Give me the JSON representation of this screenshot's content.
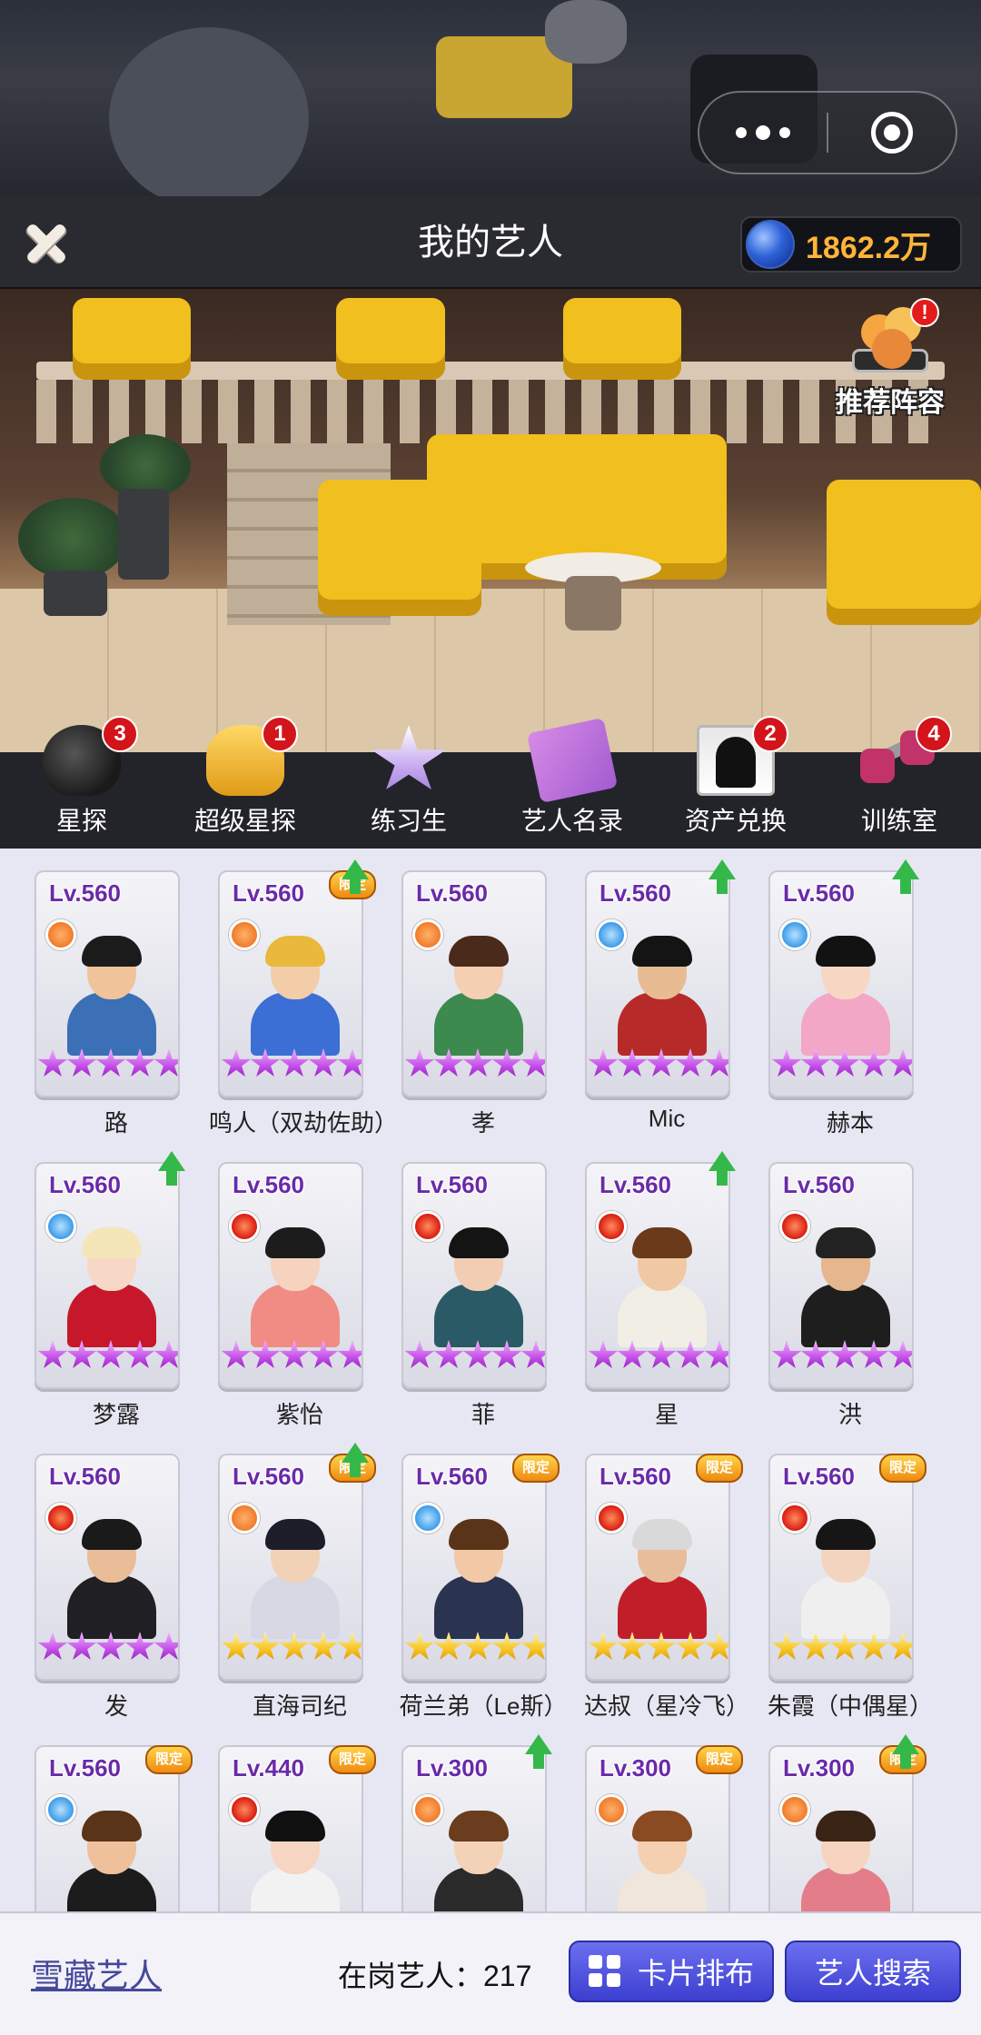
{
  "header": {
    "title": "我的艺人",
    "currency_value": "1862.2万"
  },
  "recommend": {
    "label": "推荐阵容",
    "alert": "!"
  },
  "menu": [
    {
      "label": "星探",
      "icon": "mystery-hat-icon",
      "badge": "3"
    },
    {
      "label": "超级星探",
      "icon": "golden-hat-icon",
      "badge": "1"
    },
    {
      "label": "练习生",
      "icon": "star-icon",
      "badge": ""
    },
    {
      "label": "艺人名录",
      "icon": "roster-book-icon",
      "badge": ""
    },
    {
      "label": "资产兑换",
      "icon": "silhouette-card-icon",
      "badge": "2"
    },
    {
      "label": "训练室",
      "icon": "dumbbell-icon",
      "badge": "4"
    }
  ],
  "artists": [
    {
      "level": "Lv.560",
      "name": "路",
      "element": "orange",
      "stars": "purple",
      "up": false,
      "limited": false,
      "hair": "#1b1b1b",
      "body": "#3b6fb6",
      "skin": "#f0c39a"
    },
    {
      "level": "Lv.560",
      "name": "鸣人（双劫佐助）",
      "element": "orange",
      "stars": "purple",
      "up": true,
      "limited": true,
      "limited_text": "限定",
      "hair": "#e8b93a",
      "body": "#3b6fd6",
      "skin": "#f3cda7"
    },
    {
      "level": "Lv.560",
      "name": "孝",
      "element": "orange",
      "stars": "purple",
      "up": false,
      "limited": false,
      "hair": "#4a2a1a",
      "body": "#3c8a4e",
      "skin": "#f4cfb2"
    },
    {
      "level": "Lv.560",
      "name": "Mic",
      "element": "blue",
      "stars": "purple",
      "up": true,
      "limited": false,
      "hair": "#141414",
      "body": "#b72a2a",
      "skin": "#e9bb93"
    },
    {
      "level": "Lv.560",
      "name": "赫本",
      "element": "blue",
      "stars": "purple",
      "up": true,
      "limited": false,
      "hair": "#121212",
      "body": "#f2a7c6",
      "skin": "#f7d7c4"
    },
    {
      "level": "Lv.560",
      "name": "梦露",
      "element": "blue",
      "stars": "purple",
      "up": true,
      "limited": false,
      "hair": "#f4e6b8",
      "body": "#c6182a",
      "skin": "#f7d8c6"
    },
    {
      "level": "Lv.560",
      "name": "紫怡",
      "element": "red",
      "stars": "purple",
      "up": false,
      "limited": false,
      "hair": "#1c1c1c",
      "body": "#f08c84",
      "skin": "#f6d3be"
    },
    {
      "level": "Lv.560",
      "name": "菲",
      "element": "red",
      "stars": "purple",
      "up": false,
      "limited": false,
      "hair": "#141414",
      "body": "#2a5a66",
      "skin": "#f2cdb3"
    },
    {
      "level": "Lv.560",
      "name": "星",
      "element": "red",
      "stars": "purple",
      "up": true,
      "limited": false,
      "hair": "#6a3a1a",
      "body": "#f1eee6",
      "skin": "#f0c8a4"
    },
    {
      "level": "Lv.560",
      "name": "洪",
      "element": "red",
      "stars": "purple",
      "up": false,
      "limited": false,
      "hair": "#222222",
      "body": "#1e1e1e",
      "skin": "#e6b68e"
    },
    {
      "level": "Lv.560",
      "name": "发",
      "element": "red",
      "stars": "purple",
      "up": false,
      "limited": false,
      "hair": "#1a1a1a",
      "body": "#1f1f24",
      "skin": "#e9bd98"
    },
    {
      "level": "Lv.560",
      "name": "直海司纪",
      "element": "orange",
      "stars": "gold",
      "up": true,
      "limited": true,
      "limited_text": "限定",
      "hair": "#1d1d2a",
      "body": "#d8d8e4",
      "skin": "#f2d2b6"
    },
    {
      "level": "Lv.560",
      "name": "荷兰弟（Le斯）",
      "element": "blue",
      "stars": "gold",
      "up": false,
      "limited": true,
      "limited_text": "限定",
      "hair": "#5a3418",
      "body": "#2a3350",
      "skin": "#f2c8a6"
    },
    {
      "level": "Lv.560",
      "name": "达叔（星冷飞）",
      "element": "red",
      "stars": "gold",
      "up": false,
      "limited": true,
      "limited_text": "限定",
      "hair": "#d9d9d9",
      "body": "#c21e2a",
      "skin": "#e8bd9c"
    },
    {
      "level": "Lv.560",
      "name": "朱霞（中偶星）",
      "element": "red",
      "stars": "gold",
      "up": false,
      "limited": true,
      "limited_text": "限定",
      "hair": "#161616",
      "body": "#efefef",
      "skin": "#f3d4bf"
    },
    {
      "level": "Lv.560",
      "name": "",
      "element": "blue",
      "stars": "",
      "up": false,
      "limited": true,
      "limited_text": "限定",
      "hair": "#5a3418",
      "body": "#1c1c1c",
      "skin": "#eec09c"
    },
    {
      "level": "Lv.440",
      "name": "",
      "element": "red",
      "stars": "",
      "up": false,
      "limited": true,
      "limited_text": "限定",
      "hair": "#111111",
      "body": "#f2f2f2",
      "skin": "#f6d6c2"
    },
    {
      "level": "Lv.300",
      "name": "",
      "element": "orange",
      "stars": "",
      "up": true,
      "limited": false,
      "hair": "#6a3d1e",
      "body": "#2a2a2a",
      "skin": "#f4d2b7"
    },
    {
      "level": "Lv.300",
      "name": "",
      "element": "orange",
      "stars": "",
      "up": false,
      "limited": true,
      "limited_text": "限定",
      "hair": "#8a4a22",
      "body": "#f0e6dc",
      "skin": "#f4d0b0"
    },
    {
      "level": "Lv.300",
      "name": "",
      "element": "orange",
      "stars": "",
      "up": true,
      "limited": true,
      "limited_text": "限定",
      "hair": "#3a2416",
      "body": "#e47d8a",
      "skin": "#f6d4c0"
    }
  ],
  "bottom": {
    "snow_link": "雪藏艺人",
    "on_duty": "在岗艺人：217",
    "layout_button": "卡片排布",
    "search_button": "艺人搜索"
  },
  "colors": {
    "level_text": "#6a2aa8",
    "button": "#3c3fcf",
    "currency": "#ffb53a"
  }
}
